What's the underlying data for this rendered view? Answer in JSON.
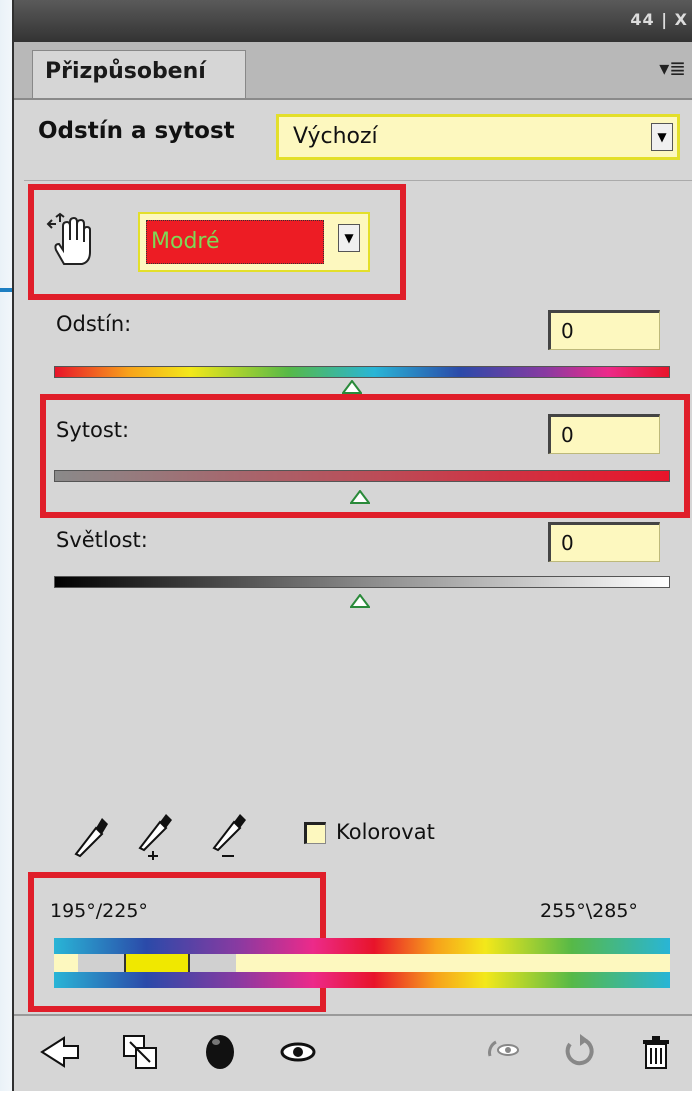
{
  "window": {
    "controls": "44 | X"
  },
  "panel": {
    "tab_label": "Přizpůsobení",
    "menu_icon": "panel-menu-icon"
  },
  "adjustment": {
    "title": "Odstín a sytost",
    "preset_value": "Výchozí"
  },
  "channel": {
    "selected": "Modré"
  },
  "sliders": {
    "hue": {
      "label": "Odstín:",
      "value": "0"
    },
    "saturation": {
      "label": "Sytost:",
      "value": "0"
    },
    "lightness": {
      "label": "Světlost:",
      "value": "0"
    }
  },
  "colorize": {
    "label": "Kolorovat",
    "checked": false
  },
  "range": {
    "left": "195°/225°",
    "right": "255°\\285°"
  },
  "icons": [
    "targeted-adjustment-hand-icon",
    "eyedropper-icon",
    "eyedropper-add-icon",
    "eyedropper-subtract-icon",
    "back-arrow-icon",
    "clip-to-layer-icon",
    "layer-mask-icon",
    "visibility-eye-icon",
    "previous-state-icon",
    "reset-icon",
    "trash-icon"
  ],
  "colors": {
    "highlight_red": "#e01e2a",
    "field_yellow": "#fdf8bf",
    "channel_red": "#ed1c24"
  }
}
